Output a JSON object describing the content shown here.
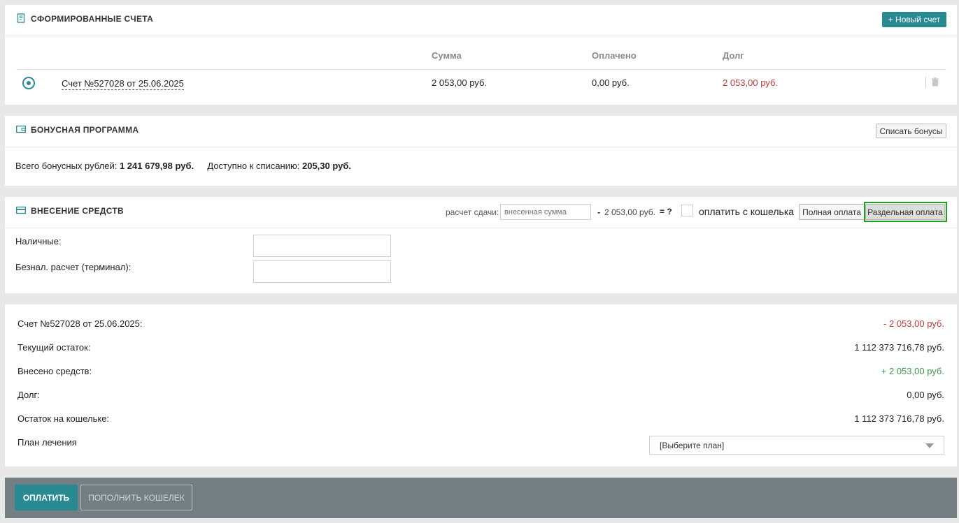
{
  "invoices": {
    "title": "СФОРМИРОВАННЫЕ СЧЕТА",
    "new_button": "+ Новый счет",
    "columns": {
      "sum": "Сумма",
      "paid": "Оплачено",
      "debt": "Долг"
    },
    "rows": [
      {
        "name": "Счет №527028 от 25.06.2025",
        "sum": "2 053,00 руб.",
        "paid": "0,00 руб.",
        "debt": "2 053,00 руб."
      }
    ]
  },
  "bonus": {
    "title": "БОНУСНАЯ ПРОГРАММА",
    "button": "Списать бонусы",
    "total_label": "Всего бонусных рублей:",
    "total_value": "1 241 679,98 руб.",
    "available_label": "Доступно к списанию:",
    "available_value": "205,30 руб."
  },
  "deposit": {
    "title": "ВНЕСЕНИЕ СРЕДСТВ",
    "change_label": "расчет сдачи:",
    "change_placeholder": "внесенная сумма",
    "minus": "-",
    "change_amount": "2 053,00 руб.",
    "equals": "= ?",
    "wallet_label": "оплатить с кошелька",
    "full_pay": "Полная оплата",
    "split_pay": "Раздельная оплата",
    "cash_label": "Наличные:",
    "card_label": "Безнал. расчет (терминал):"
  },
  "summary": {
    "rows": [
      {
        "label": "Счет №527028 от 25.06.2025:",
        "value": "- 2 053,00 руб.",
        "tone": "red"
      },
      {
        "label": "Текущий остаток:",
        "value": "1 112 373 716,78 руб.",
        "tone": "normal"
      },
      {
        "label": "Внесено средств:",
        "value": "+ 2 053,00 руб.",
        "tone": "green"
      },
      {
        "label": "Долг:",
        "value": "0,00 руб.",
        "tone": "normal"
      },
      {
        "label": "Остаток на кошельке:",
        "value": "1 112 373 716,78 руб.",
        "tone": "normal"
      }
    ],
    "plan_label": "План лечения",
    "plan_select": "[Выберите план]"
  },
  "footer": {
    "pay_button": "ОПЛАТИТЬ",
    "topup_button": "ПОПОЛНИТЬ КОШЕЛЕК"
  },
  "colors": {
    "accent": "#2a8a92",
    "debt": "#c0393b",
    "positive": "#3c9a4a",
    "highlight": "#1fa31f"
  }
}
